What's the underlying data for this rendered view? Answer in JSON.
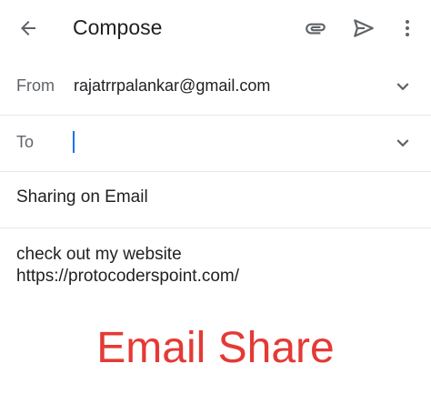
{
  "appbar": {
    "title": "Compose",
    "icons": {
      "back": "arrow-back-icon",
      "attach": "attachment-icon",
      "send": "send-icon",
      "more": "more-vert-icon"
    }
  },
  "from": {
    "label": "From",
    "value": "rajatrrpalankar@gmail.com"
  },
  "to": {
    "label": "To",
    "value": ""
  },
  "subject": {
    "value": "Sharing on Email"
  },
  "body": {
    "lines": [
      "check out my website",
      "https://protocoderspoint.com/"
    ]
  },
  "overlay": {
    "text": "Email Share",
    "color": "#e53935"
  },
  "colors": {
    "cursor": "#1a73e8",
    "icon": "#5f6368"
  }
}
